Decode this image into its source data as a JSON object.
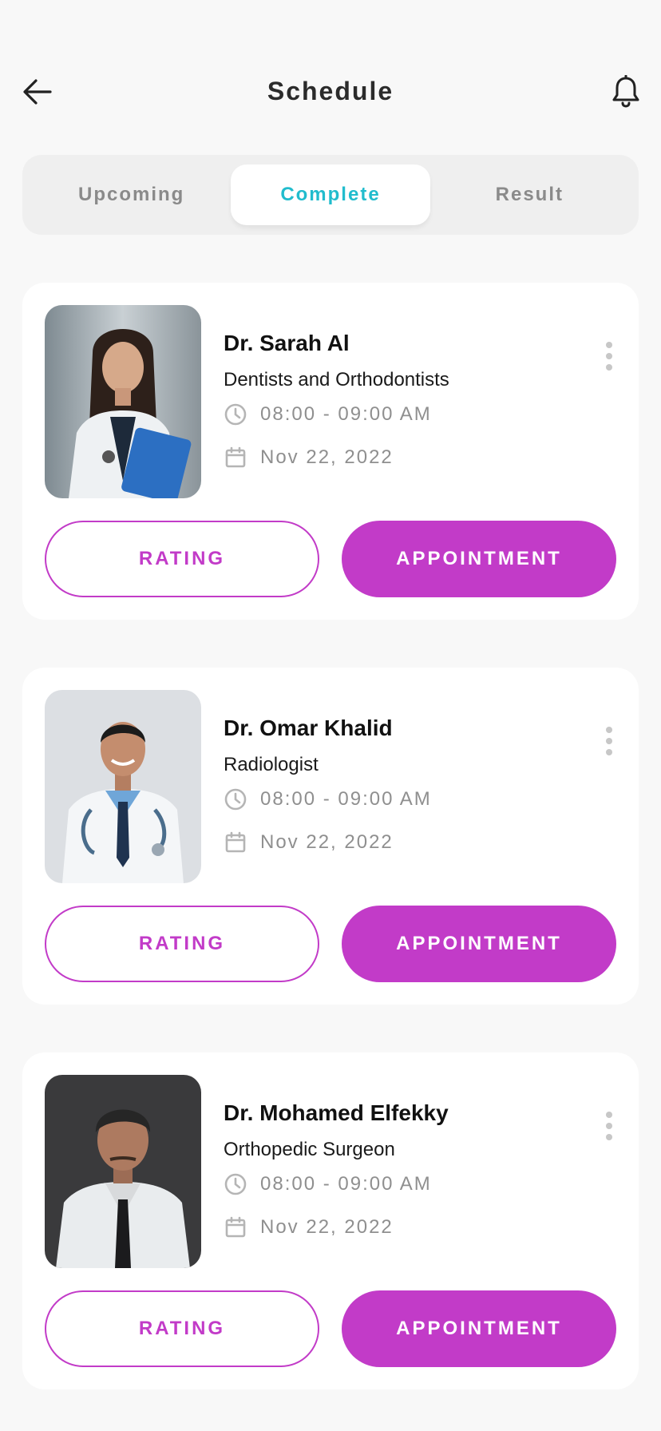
{
  "header": {
    "title": "Schedule",
    "back_icon": "arrow-left-icon",
    "bell_icon": "bell-icon"
  },
  "tabs": [
    {
      "label": "Upcoming",
      "active": false
    },
    {
      "label": "Complete",
      "active": true
    },
    {
      "label": "Result",
      "active": false
    }
  ],
  "colors": {
    "accent": "#c23bc8",
    "active_tab": "#21bccd",
    "background": "#f8f8f8",
    "card": "#ffffff",
    "muted_text": "#8f8f8f"
  },
  "appointments": [
    {
      "name": "Dr. Sarah Al",
      "specialty": "Dentists and Orthodontists",
      "time": "08:00 - 09:00 AM",
      "date": "Nov 22, 2022",
      "rating_label": "RATING",
      "appointment_label": "APPOINTMENT"
    },
    {
      "name": "Dr. Omar Khalid",
      "specialty": "Radiologist",
      "time": "08:00 - 09:00 AM",
      "date": "Nov 22, 2022",
      "rating_label": "RATING",
      "appointment_label": "APPOINTMENT"
    },
    {
      "name": "Dr. Mohamed Elfekky",
      "specialty": "Orthopedic Surgeon",
      "time": "08:00 - 09:00 AM",
      "date": "Nov 22, 2022",
      "rating_label": "RATING",
      "appointment_label": "APPOINTMENT"
    }
  ]
}
